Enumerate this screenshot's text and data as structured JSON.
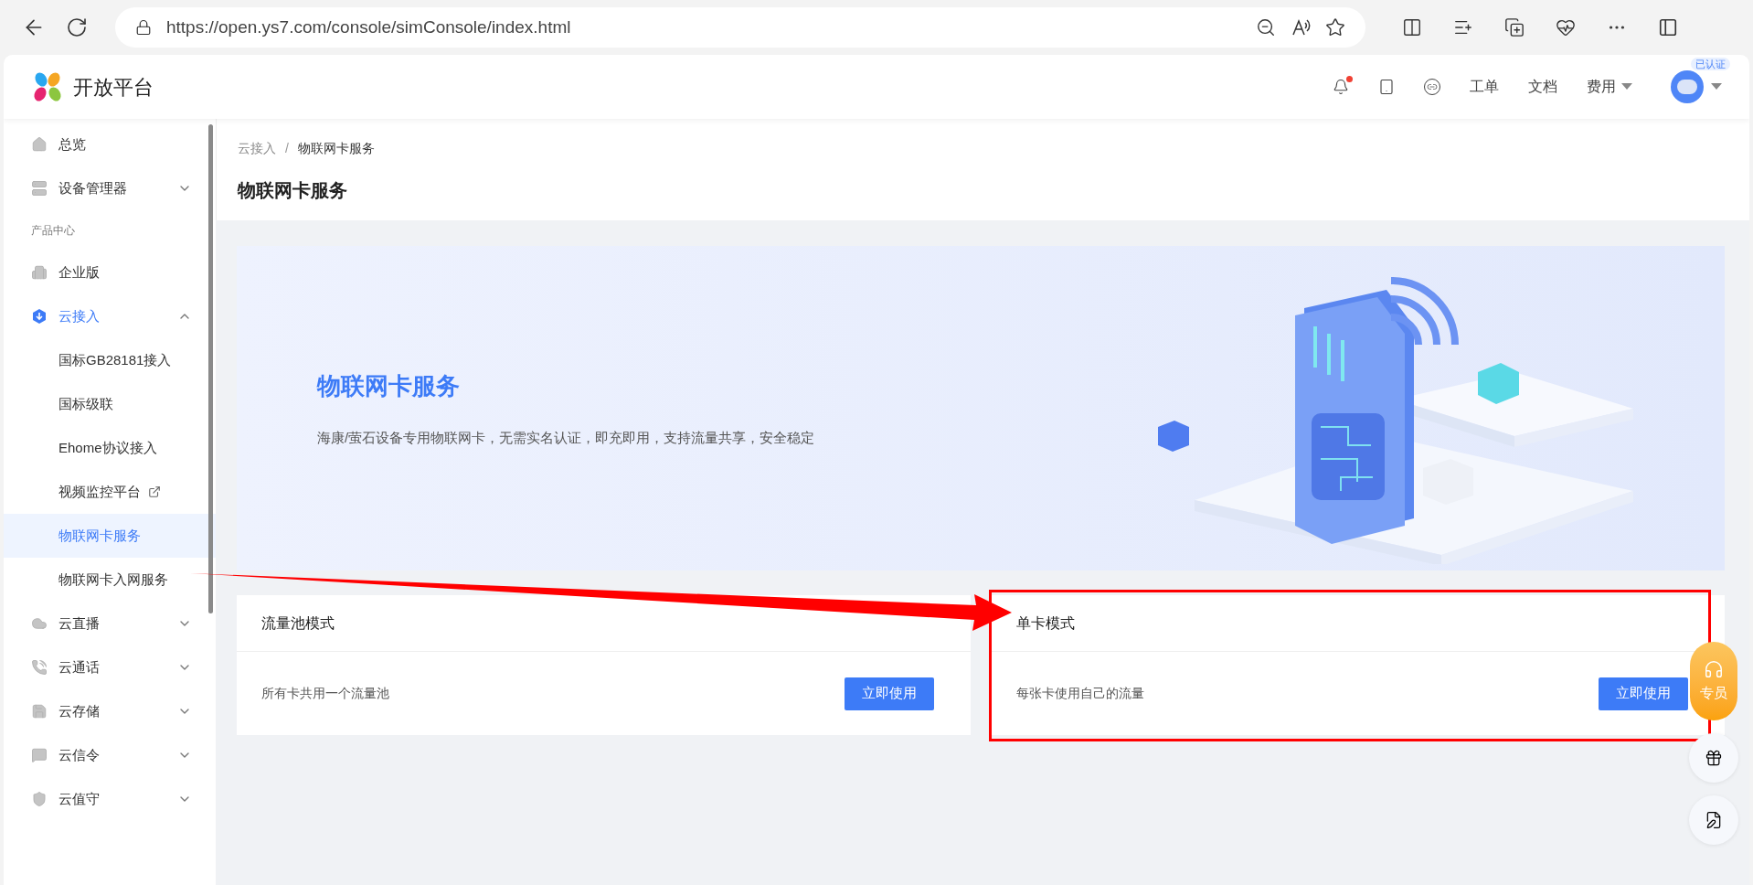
{
  "browser": {
    "url": "https://open.ys7.com/console/simConsole/index.html"
  },
  "header": {
    "logo": "开放平台",
    "notification_unread": true,
    "links": [
      {
        "label": "工单",
        "dropdown": false
      },
      {
        "label": "文档",
        "dropdown": false
      },
      {
        "label": "费用",
        "dropdown": true
      }
    ],
    "account_badge": "已认证"
  },
  "sidebar": {
    "items": [
      {
        "kind": "link",
        "label": "总览",
        "selected": false
      },
      {
        "kind": "group",
        "label": "设备管理器",
        "selected": false,
        "expanded": false
      },
      {
        "kind": "section",
        "label": "产品中心"
      },
      {
        "kind": "link",
        "label": "企业版",
        "selected": false
      },
      {
        "kind": "group",
        "label": "云接入",
        "selected": true,
        "expanded": true,
        "children": [
          {
            "label": "国标GB28181接入",
            "selected": false,
            "external": false
          },
          {
            "label": "国标级联",
            "selected": false,
            "external": false
          },
          {
            "label": "Ehome协议接入",
            "selected": false,
            "external": false
          },
          {
            "label": "视频监控平台",
            "selected": false,
            "external": true
          },
          {
            "label": "物联网卡服务",
            "selected": true,
            "external": false
          },
          {
            "label": "物联网卡入网服务",
            "selected": false,
            "external": false
          }
        ]
      },
      {
        "kind": "group",
        "label": "云直播",
        "selected": false,
        "expanded": false
      },
      {
        "kind": "group",
        "label": "云通话",
        "selected": false,
        "expanded": false
      },
      {
        "kind": "group",
        "label": "云存储",
        "selected": false,
        "expanded": false
      },
      {
        "kind": "group",
        "label": "云信令",
        "selected": false,
        "expanded": false
      },
      {
        "kind": "group",
        "label": "云值守",
        "selected": false,
        "expanded": false
      }
    ]
  },
  "breadcrumb": [
    "云接入",
    "物联网卡服务"
  ],
  "breadcrumb_separator": "/",
  "page_title": "物联网卡服务",
  "banner": {
    "title": "物联网卡服务",
    "description": "海康/萤石设备专用物联网卡，无需实名认证，即充即用，支持流量共享，安全稳定"
  },
  "cards": [
    {
      "title": "流量池模式",
      "description": "所有卡共用一个流量池",
      "button": "立即使用",
      "highlighted": false
    },
    {
      "title": "单卡模式",
      "description": "每张卡使用自己的流量",
      "button": "立即使用",
      "highlighted": true
    }
  ],
  "float_buttons": {
    "agent": "专员"
  }
}
